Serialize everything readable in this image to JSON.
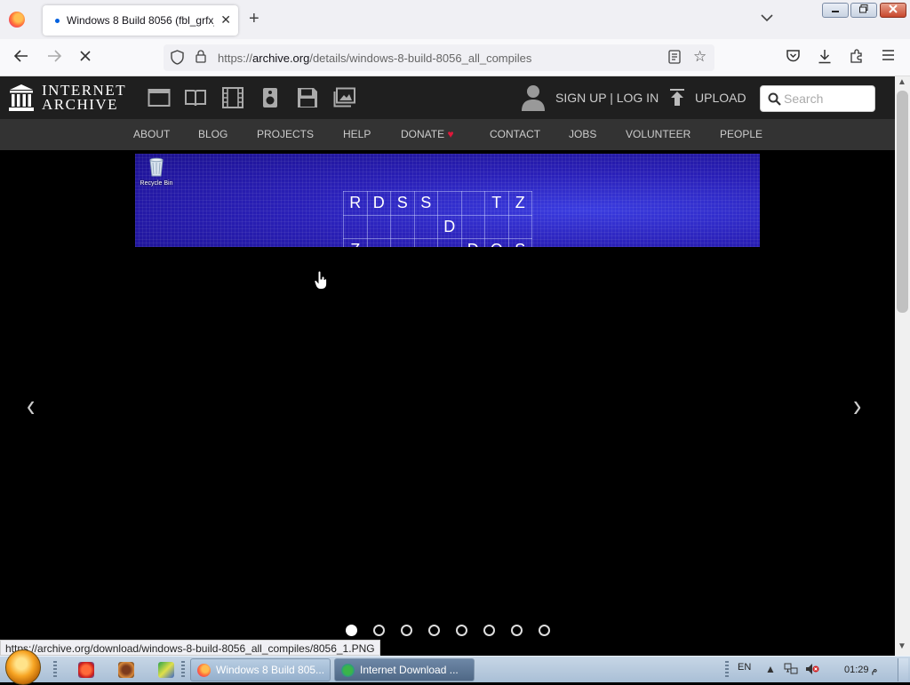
{
  "browser": {
    "tab_title": "Windows 8 Build 8056 (fbl_grfx_",
    "tab_close": "✕",
    "new_tab": "+",
    "url_host": "archive.org",
    "url_prefix": "https://",
    "url_path": "/details/windows-8-build-8056_all_compiles",
    "url_full": "https://archive.org/details/windows-8-build-8056_all_compiles",
    "status_link": "https://archive.org/download/windows-8-build-8056_all_compiles/8056_1.PNG"
  },
  "ia_header": {
    "logo_line1": "INTERNET",
    "logo_line2": "ARCHIVE",
    "signup": "SIGN UP | LOG IN",
    "upload": "UPLOAD",
    "search_placeholder": "Search"
  },
  "ia_nav": {
    "items": [
      "ABOUT",
      "BLOG",
      "PROJECTS",
      "HELP",
      "DONATE",
      "CONTACT",
      "JOBS",
      "VOLUNTEER",
      "PEOPLE"
    ],
    "donate_heart": "♥"
  },
  "slide": {
    "recycle_label": "Recycle Bin",
    "grid": [
      [
        "R",
        "D",
        "S",
        "S",
        "",
        "",
        "T",
        "Z"
      ],
      [
        "",
        "",
        "",
        "",
        "D",
        "",
        "",
        ""
      ],
      [
        "Z",
        "",
        "",
        "",
        "",
        "D",
        "Q",
        "S"
      ]
    ],
    "dots_total": 8,
    "active_dot": 1,
    "prev_arrow": "‹",
    "next_arrow": "›"
  },
  "taskbar": {
    "task1": "Windows 8 Build 805...",
    "task2": "Internet Download ...",
    "lang": "EN",
    "clock": "01:29 م"
  },
  "colors": {
    "ia_header_bg": "#1f1f1f",
    "ia_nav_bg": "#333333",
    "slide_blue": "#2a20b8",
    "donate_heart": "#e0173a"
  }
}
